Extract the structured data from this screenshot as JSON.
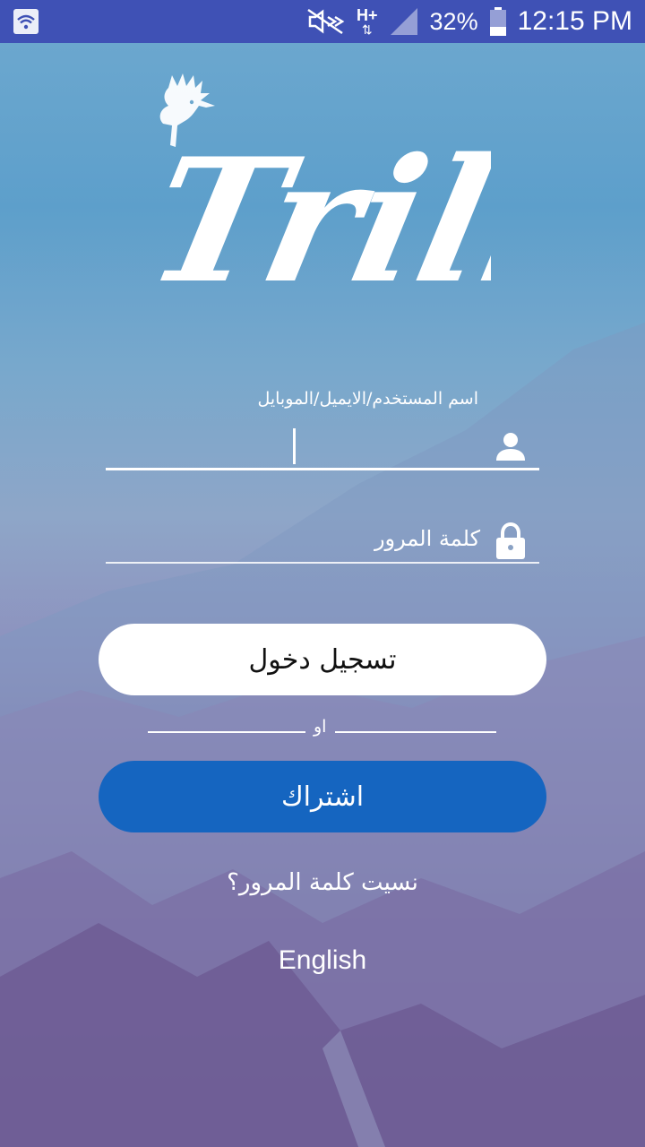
{
  "status_bar": {
    "battery": "32%",
    "time": "12:15 PM",
    "network": "H+",
    "icons": [
      "wifi-icon",
      "mute-icon",
      "signal-icon",
      "battery-icon"
    ]
  },
  "app": {
    "logo_text": "Trill"
  },
  "login_form": {
    "username_label": "اسم المستخدم/الايميل/الموبايل",
    "username_value": "",
    "password_placeholder": "كلمة المرور",
    "login_button": "تسجيل دخول",
    "or_text": "او",
    "signup_button": "اشتراك",
    "forgot_password": "نسيت كلمة المرور؟",
    "language_link": "English"
  },
  "colors": {
    "status_bar": "#3f51b5",
    "signup_button": "#1565c0",
    "login_button": "#ffffff"
  }
}
